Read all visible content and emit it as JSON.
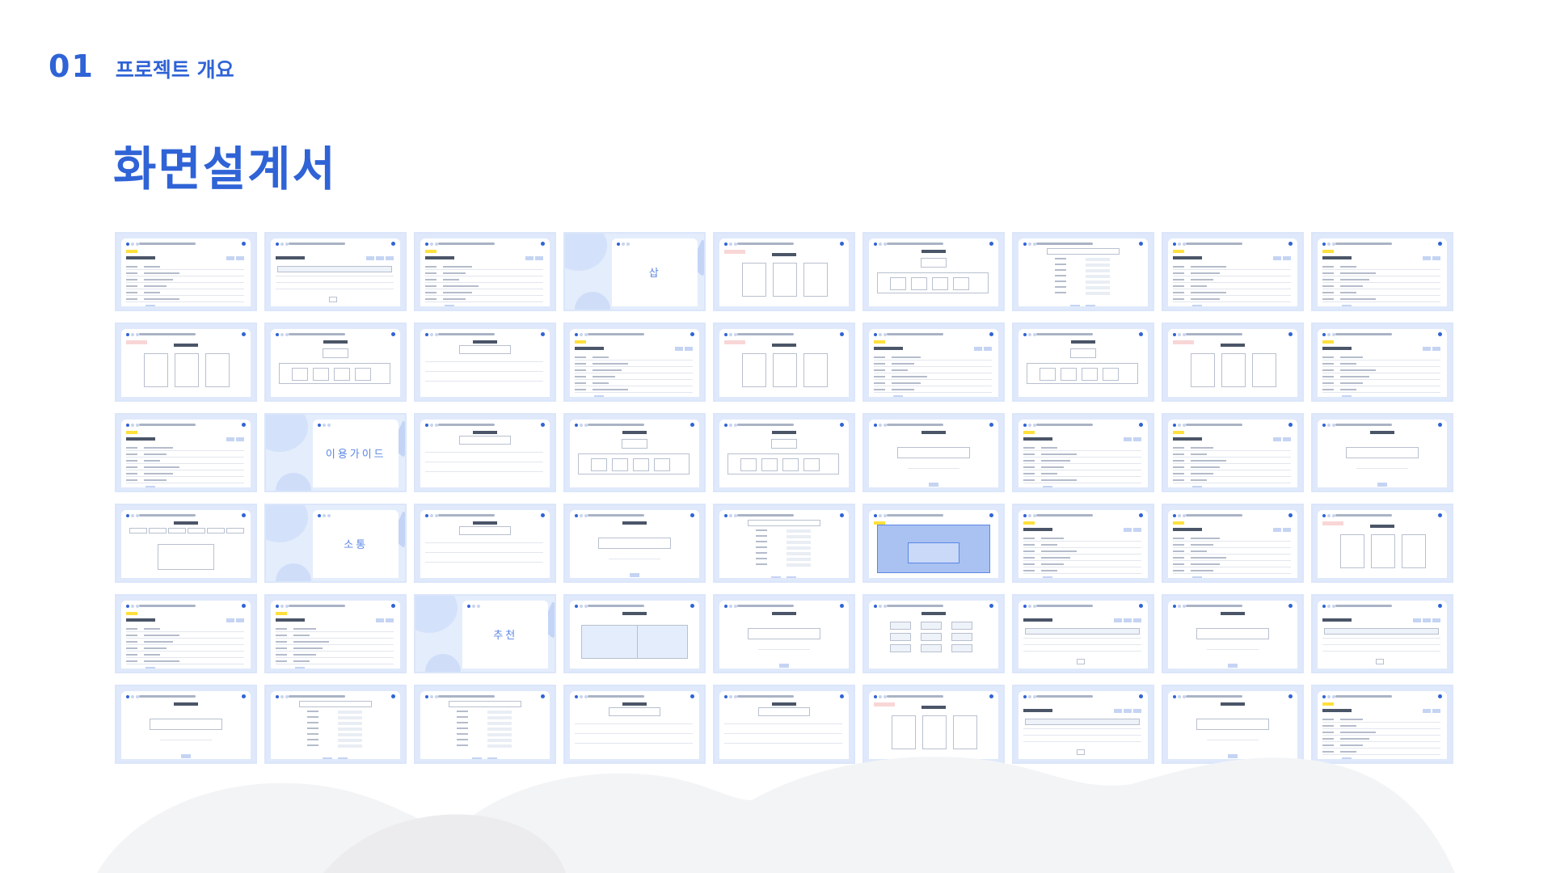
{
  "header": {
    "section_number": "01",
    "section_title": "프로젝트 개요"
  },
  "page_title": "화면설계서",
  "covers": {
    "buy": "삽",
    "guide": "이용가이드",
    "community": "소통",
    "recommend": "추천"
  },
  "thumbnail_count": 54
}
